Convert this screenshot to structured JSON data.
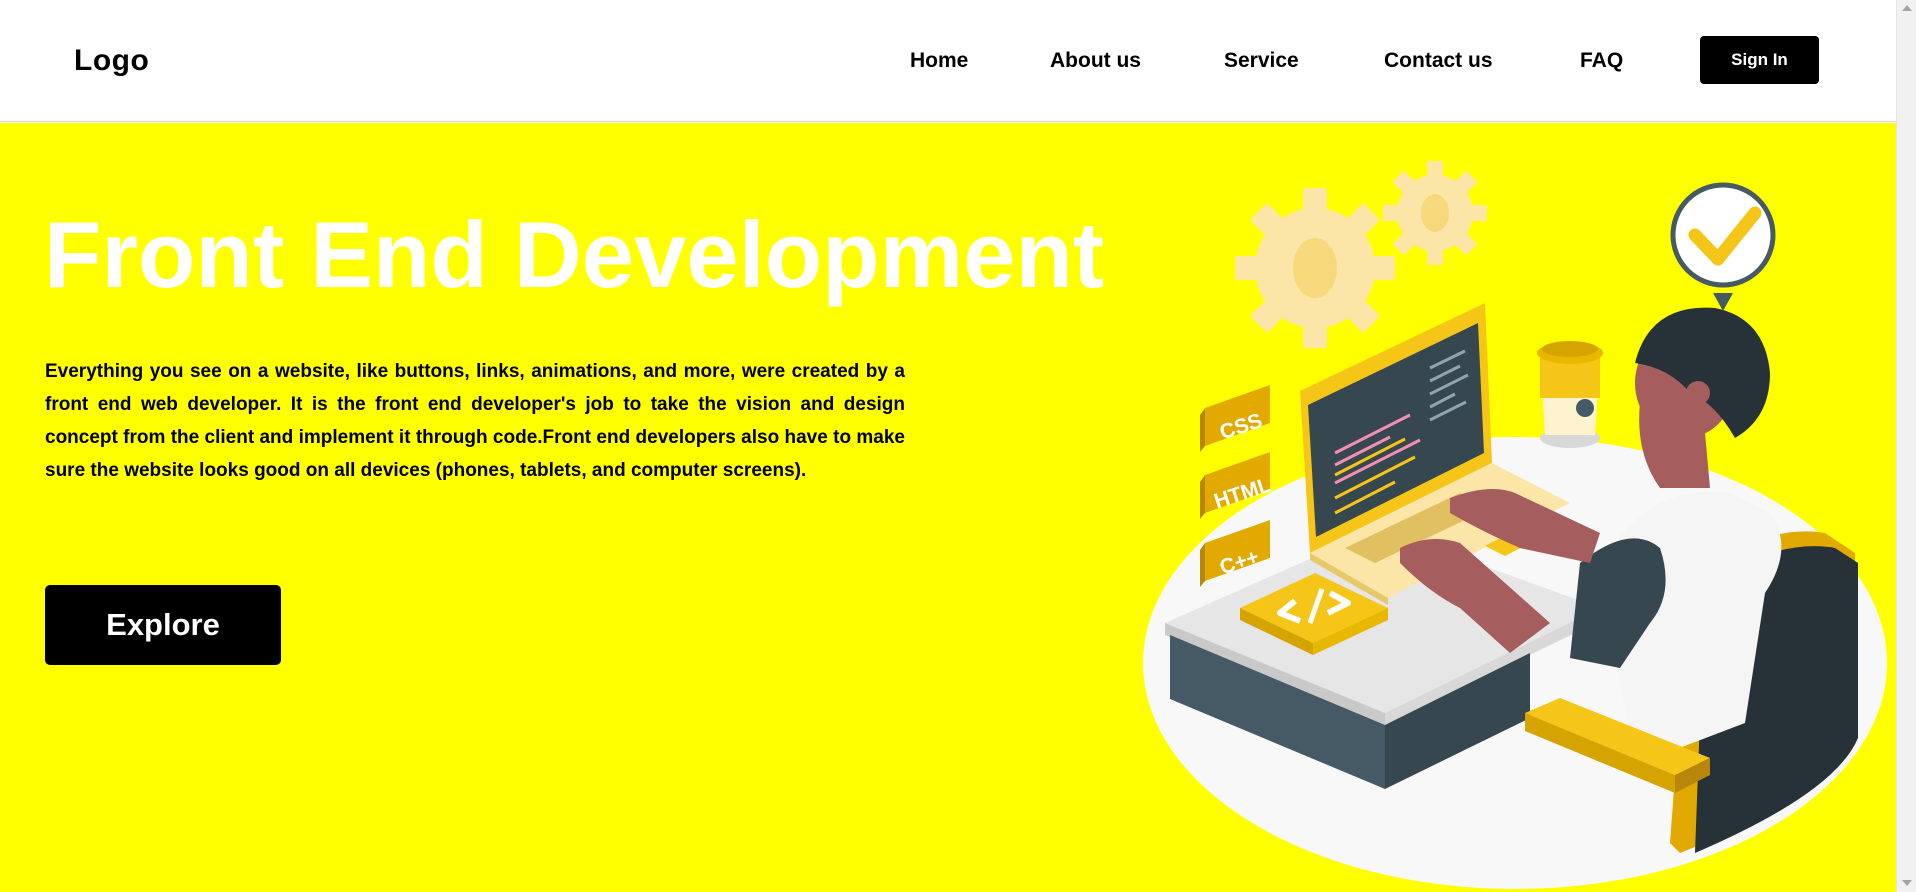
{
  "header": {
    "logo": "Logo",
    "nav": [
      {
        "label": "Home"
      },
      {
        "label": "About us"
      },
      {
        "label": "Service"
      },
      {
        "label": "Contact us"
      },
      {
        "label": "FAQ"
      }
    ],
    "sign_in": "Sign In"
  },
  "hero": {
    "title": "Front End Development",
    "description": "Everything you see on a website, like buttons, links, animations, and more, were created by a front end web developer. It is the front end developer's job to take the vision and design concept from the client and implement it through code.Front end developers also have to make sure the website looks good on all devices (phones, tablets, and computer screens).",
    "explore_button": "Explore",
    "illustration": {
      "badges": [
        "CSS",
        "HTML",
        "C++"
      ],
      "icons": [
        "gear-icon",
        "check-icon",
        "code-icon",
        "coffee-cup"
      ]
    }
  },
  "colors": {
    "hero_bg": "#ffff00",
    "accent": "#f5c518",
    "dark": "#263238",
    "button": "#000000"
  }
}
